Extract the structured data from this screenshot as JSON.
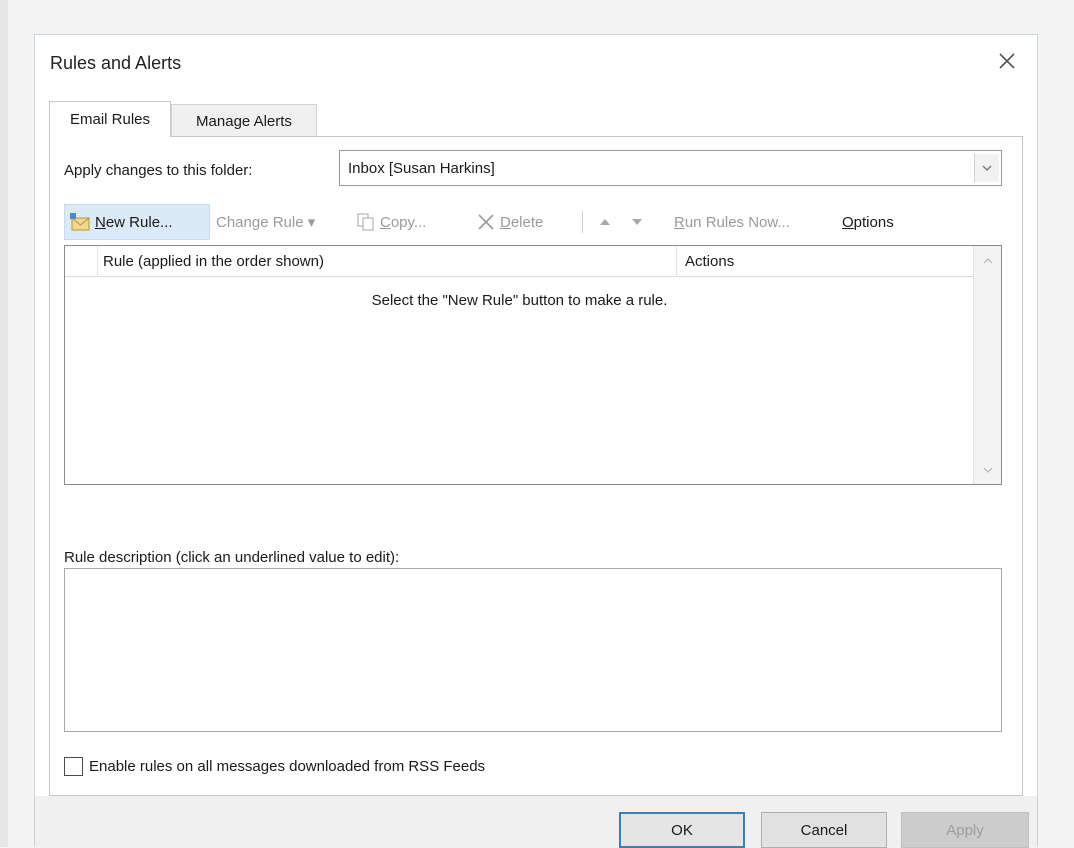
{
  "window": {
    "title": "Rules and Alerts"
  },
  "tabs": [
    {
      "label": "Email Rules",
      "active": true
    },
    {
      "label": "Manage Alerts",
      "active": false
    }
  ],
  "folder": {
    "label": "Apply changes to this folder:",
    "value": "Inbox [Susan Harkins]"
  },
  "toolbar": {
    "new_rule": {
      "prefix": "",
      "underline": "N",
      "suffix": "ew Rule...",
      "enabled": true
    },
    "change_rule": {
      "label": "Change Rule ▾",
      "enabled": false
    },
    "copy": {
      "prefix": "",
      "underline": "C",
      "suffix": "opy...",
      "enabled": false
    },
    "delete": {
      "prefix": "",
      "underline": "D",
      "suffix": "elete",
      "enabled": false
    },
    "run_rules": {
      "prefix": "",
      "underline": "R",
      "suffix": "un Rules Now...",
      "enabled": false
    },
    "options": {
      "prefix": "",
      "underline": "O",
      "suffix": "ptions",
      "enabled": true
    }
  },
  "rules_table": {
    "columns": [
      "Rule (applied in the order shown)",
      "Actions"
    ],
    "rows": [],
    "empty_message": "Select the \"New Rule\" button to make a rule."
  },
  "description": {
    "label": "Rule description (click an underlined value to edit):",
    "text": ""
  },
  "rss": {
    "label": "Enable rules on all messages downloaded from RSS Feeds",
    "checked": false
  },
  "buttons": {
    "ok": "OK",
    "cancel": "Cancel",
    "apply": "Apply"
  },
  "colors": {
    "accent": "#3c7fb1",
    "selected_toolbar_bg": "#dce9f6",
    "disabled_text": "#9b9b9b"
  },
  "icons": {
    "close": "close-icon",
    "dropdown": "chevron-down-icon",
    "new_rule": "new-rule-icon",
    "copy": "copy-icon",
    "delete": "delete-x-icon",
    "move_up": "arrow-up-icon",
    "move_down": "arrow-down-icon",
    "scroll_up": "scroll-up-icon",
    "scroll_down": "scroll-down-icon"
  }
}
